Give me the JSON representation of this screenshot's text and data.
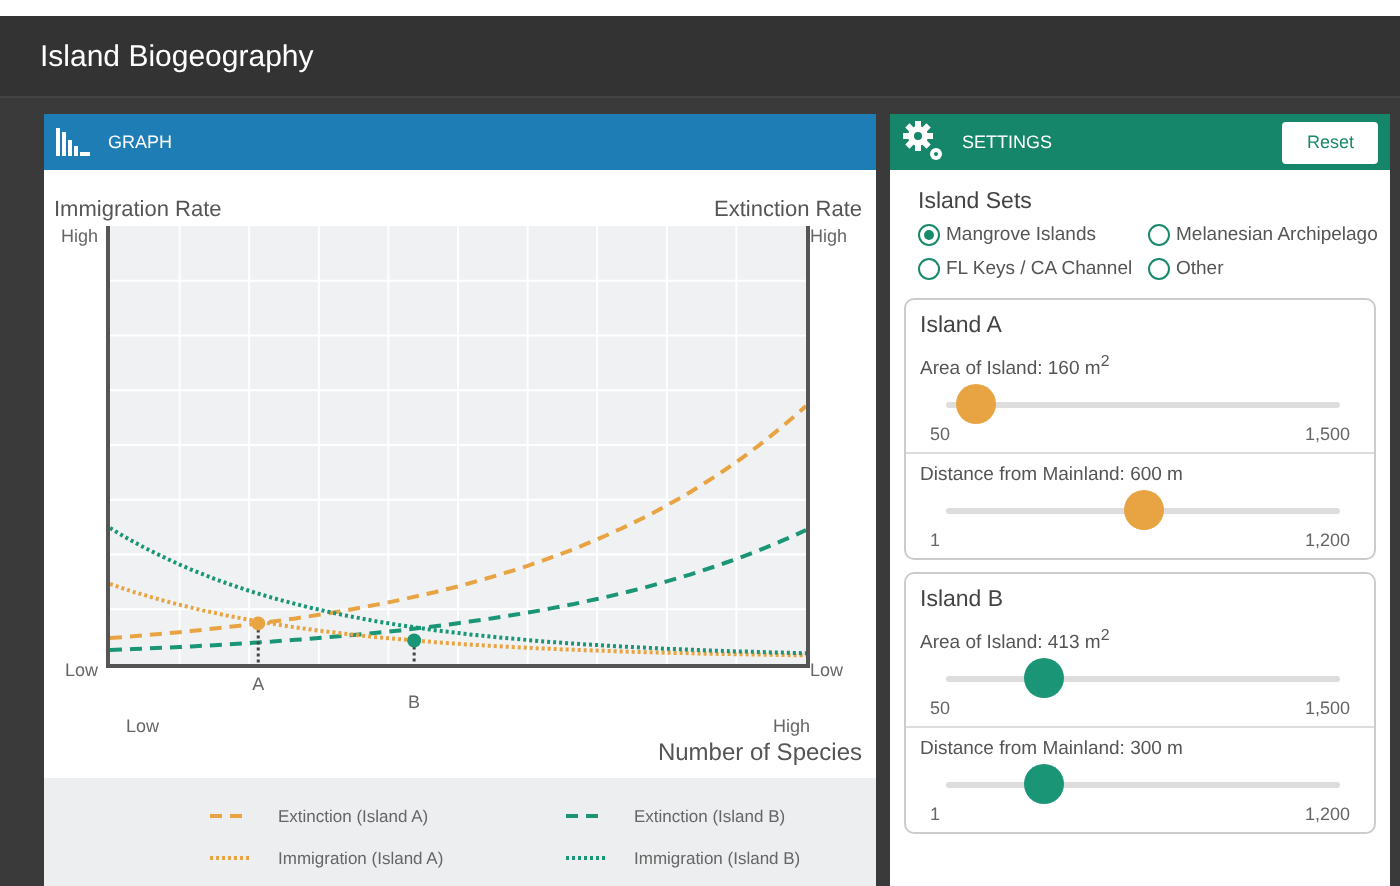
{
  "window": {
    "title": "Island Biogeography"
  },
  "graph": {
    "title": "GRAPH",
    "y_left_title": "Immigration Rate",
    "y_right_title": "Extinction Rate",
    "y_left_high": "High",
    "y_left_low": "Low",
    "y_right_high": "High",
    "y_right_low": "Low",
    "x_low": "Low",
    "x_high": "High",
    "x_title": "Number of Species",
    "markers": [
      {
        "label": "A",
        "color": "#e8a443"
      },
      {
        "label": "B",
        "color": "#1a9677"
      }
    ],
    "legend": [
      {
        "label": "Extinction (Island A)",
        "color": "#e8a443",
        "kind": "dashed"
      },
      {
        "label": "Extinction (Island B)",
        "color": "#1a9677",
        "kind": "dashed"
      },
      {
        "label": "Immigration (Island A)",
        "color": "#e8a443",
        "kind": "dotted"
      },
      {
        "label": "Immigration (Island B)",
        "color": "#1a9677",
        "kind": "dotted"
      }
    ]
  },
  "settings": {
    "title": "SETTINGS",
    "reset": "Reset",
    "sets_title": "Island Sets",
    "sets": [
      {
        "label": "Mangrove Islands",
        "selected": true
      },
      {
        "label": "Melanesian Archipelago",
        "selected": false
      },
      {
        "label": "FL Keys / CA Channel",
        "selected": false
      },
      {
        "label": "Other",
        "selected": false
      }
    ],
    "islands": [
      {
        "name": "Island A",
        "color": "#e8a443",
        "sliders": [
          {
            "label": "Area of Island: 160 m$^{2}$",
            "level": 0.076,
            "min": "50",
            "max": "1,500"
          },
          {
            "label": "Distance from Mainland: 600 m",
            "level": 0.5,
            "min": "1",
            "max": "1,200"
          }
        ]
      },
      {
        "name": "Island B",
        "color": "#1a9677",
        "sliders": [
          {
            "label": "Area of Island: 413 m$^{2}$",
            "level": 0.25,
            "min": "50",
            "max": "1,500"
          },
          {
            "label": "Distance from Mainland: 300 m",
            "level": 0.25,
            "min": "1",
            "max": "1,200"
          }
        ]
      }
    ]
  }
}
